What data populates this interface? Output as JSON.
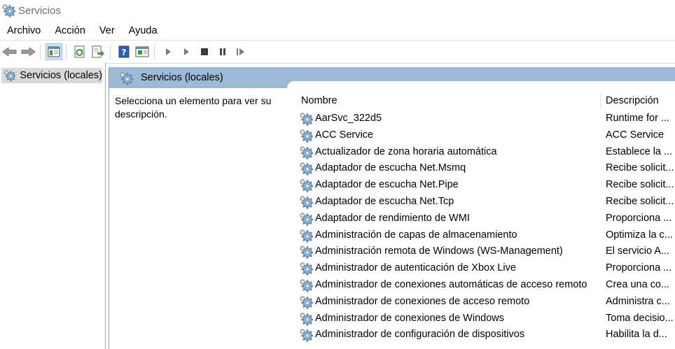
{
  "window": {
    "title": "Servicios"
  },
  "menu": [
    "Archivo",
    "Acción",
    "Ver",
    "Ayuda"
  ],
  "toolbar": {
    "icons": [
      "back-arrow-icon",
      "forward-arrow-icon",
      "show-hide-tree-icon",
      "refresh-icon",
      "export-list-icon",
      "help-icon",
      "properties-icon",
      "start-service-icon",
      "start-service-alt-icon",
      "stop-service-icon",
      "pause-service-icon",
      "resume-service-icon"
    ]
  },
  "tree": {
    "selected_label": "Servicios (locales)"
  },
  "pane": {
    "title": "Servicios (locales)",
    "hint": "Selecciona un elemento para ver su descripción."
  },
  "table": {
    "columns": {
      "name": "Nombre",
      "description": "Descripción"
    },
    "rows": [
      {
        "name": "AarSvc_322d5",
        "description": "Runtime for ..."
      },
      {
        "name": "ACC Service",
        "description": "ACC Service"
      },
      {
        "name": "Actualizador de zona horaria automática",
        "description": "Establece la ..."
      },
      {
        "name": "Adaptador de escucha Net.Msmq",
        "description": "Recibe solicit..."
      },
      {
        "name": "Adaptador de escucha Net.Pipe",
        "description": "Recibe solicit..."
      },
      {
        "name": "Adaptador de escucha Net.Tcp",
        "description": "Recibe solicit..."
      },
      {
        "name": "Adaptador de rendimiento de WMI",
        "description": "Proporciona ..."
      },
      {
        "name": "Administración de capas de almacenamiento",
        "description": "Optimiza la c..."
      },
      {
        "name": "Administración remota de Windows (WS-Management)",
        "description": "El servicio A..."
      },
      {
        "name": "Administrador de autenticación de Xbox Live",
        "description": "Proporciona ..."
      },
      {
        "name": "Administrador de conexiones automáticas de acceso remoto",
        "description": "Crea una co..."
      },
      {
        "name": "Administrador de conexiones de acceso remoto",
        "description": "Administra c..."
      },
      {
        "name": "Administrador de conexiones de Windows",
        "description": "Toma decisio..."
      },
      {
        "name": "Administrador de configuración de dispositivos",
        "description": "Habilita la d..."
      }
    ]
  }
}
